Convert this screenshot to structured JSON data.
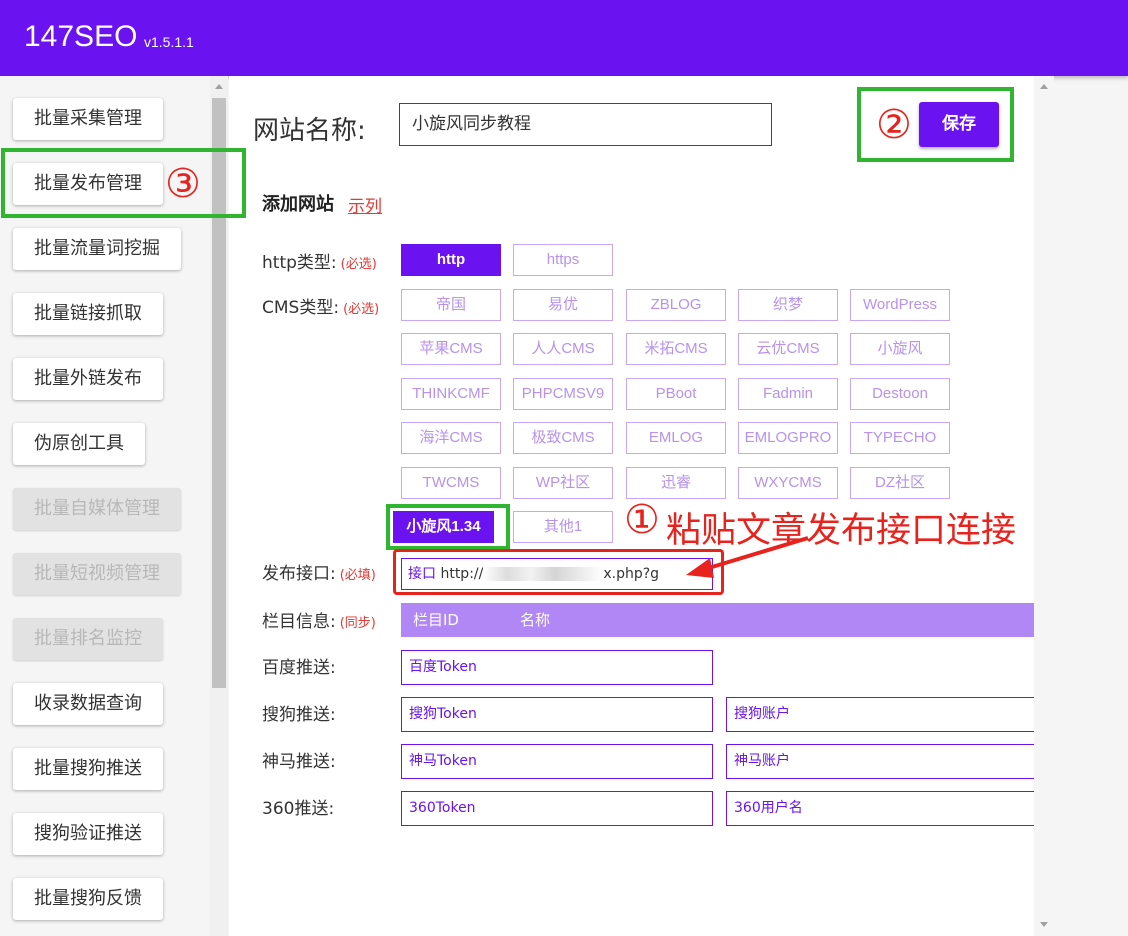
{
  "header": {
    "title": "147SEO",
    "version": "v1.5.1.1"
  },
  "sidebar": {
    "items": [
      {
        "label": "批量采集管理",
        "disabled": false
      },
      {
        "label": "批量发布管理",
        "disabled": false
      },
      {
        "label": "批量流量词挖掘",
        "disabled": false
      },
      {
        "label": "批量链接抓取",
        "disabled": false
      },
      {
        "label": "批量外链发布",
        "disabled": false
      },
      {
        "label": "伪原创工具",
        "disabled": false
      },
      {
        "label": "批量自媒体管理",
        "disabled": true
      },
      {
        "label": "批量短视频管理",
        "disabled": true
      },
      {
        "label": "批量排名监控",
        "disabled": true
      },
      {
        "label": "收录数据查询",
        "disabled": false
      },
      {
        "label": "批量搜狗推送",
        "disabled": false
      },
      {
        "label": "搜狗验证推送",
        "disabled": false
      },
      {
        "label": "批量搜狗反馈",
        "disabled": false
      }
    ]
  },
  "form": {
    "site_name_label": "网站名称:",
    "site_name_value": "小旋风同步教程",
    "save_label": "保存",
    "section_title": "添加网站",
    "example_link": "示列",
    "http_label": "http类型:",
    "cms_label": "CMS类型:",
    "required_tag": "(必选)",
    "http_options": [
      {
        "label": "http",
        "selected": true
      },
      {
        "label": "https",
        "selected": false
      }
    ],
    "cms_options": [
      "帝国",
      "易优",
      "ZBLOG",
      "织梦",
      "WordPress",
      "苹果CMS",
      "人人CMS",
      "米拓CMS",
      "云优CMS",
      "小旋风",
      "THINKCMF",
      "PHPCMSV9",
      "PBoot",
      "Fadmin",
      "Destoon",
      "海洋CMS",
      "极致CMS",
      "EMLOG",
      "EMLOGPRO",
      "TYPECHO",
      "TWCMS",
      "WP社区",
      "迅睿",
      "WXYCMS",
      "DZ社区",
      "小旋风1.34",
      "其他1"
    ],
    "cms_selected": "小旋风1.34",
    "api_label": "发布接口:",
    "api_required_tag": "(必填)",
    "api_prefix": "接口",
    "api_value_start": "http://",
    "api_value_end": "x.php?g",
    "column_label": "栏目信息:",
    "column_tag": "(同步)",
    "column_id_header": "栏目ID",
    "column_name_header": "名称",
    "baidu_label": "百度推送:",
    "baidu_token_placeholder": "百度Token",
    "sogou_label": "搜狗推送:",
    "sogou_token_placeholder": "搜狗Token",
    "sogou_account_placeholder": "搜狗账户",
    "shenma_label": "神马推送:",
    "shenma_token_placeholder": "神马Token",
    "shenma_account_placeholder": "神马账户",
    "s360_label": "360推送:",
    "s360_token_placeholder": "360Token",
    "s360_user_placeholder": "360用户名"
  },
  "annotations": {
    "step1_num": "①",
    "step1_text": "粘贴文章发布接口连接",
    "step2_num": "②",
    "step3_num": "③"
  },
  "colors": {
    "accent": "#6a12f0",
    "annotation_red": "#e8231d",
    "annotation_green": "#2fb52f"
  }
}
